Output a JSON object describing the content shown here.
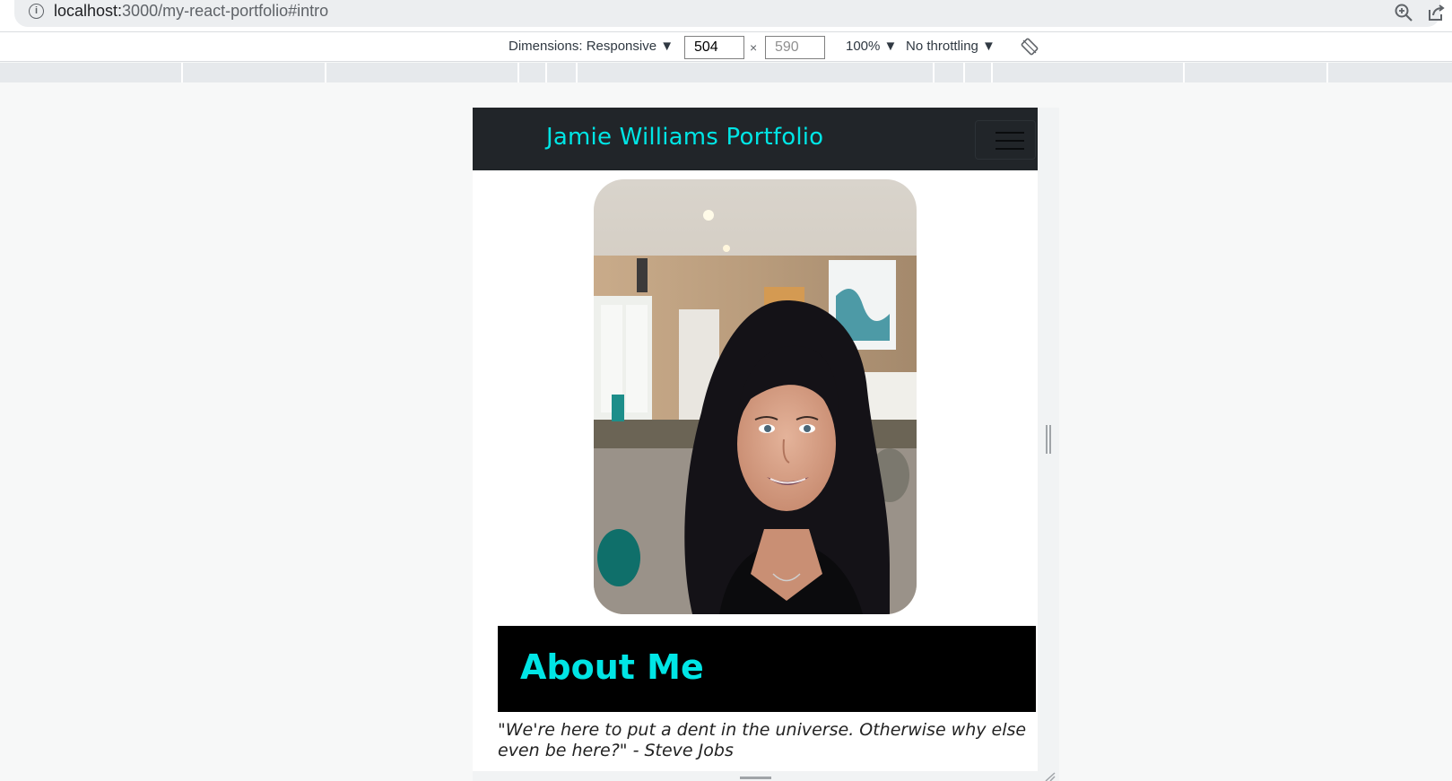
{
  "browser": {
    "url_host": "localhost:",
    "url_path": "3000/my-react-portfolio#intro"
  },
  "devtools": {
    "dimensions_label": "Dimensions: Responsive ▼",
    "width_value": "504",
    "height_value": "590",
    "times_symbol": "×",
    "zoom_label": "100% ▼",
    "throttle_label": "No throttling ▼",
    "icons": [
      "info-icon",
      "zoom-icon",
      "share-icon",
      "rotate-icon"
    ]
  },
  "site": {
    "brand": "Jamie Williams Portfolio",
    "about_title": "About Me",
    "quote": "\"We're here to put a dent in the universe. Otherwise why else even be here?\" - Steve Jobs",
    "accent_color": "#00e5e5",
    "navbar_color": "#212529"
  }
}
